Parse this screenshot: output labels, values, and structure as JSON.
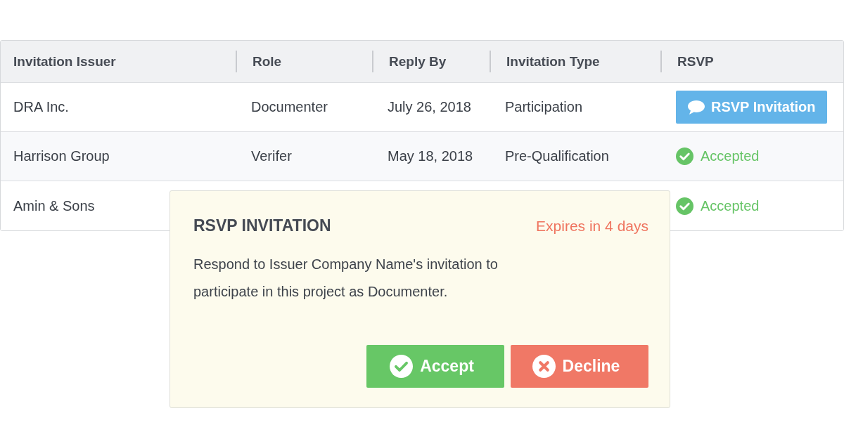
{
  "table": {
    "columns": [
      "Invitation Issuer",
      "Role",
      "Reply By",
      "Invitation Type",
      "RSVP"
    ],
    "rows": [
      {
        "issuer": "DRA Inc.",
        "role": "Documenter",
        "reply_by": "July 26, 2018",
        "invitation_type": "Participation",
        "rsvp": {
          "kind": "button",
          "label": "RSVP Invitation"
        }
      },
      {
        "issuer": "Harrison Group",
        "role": "Verifer",
        "reply_by": "May 18, 2018",
        "invitation_type": "Pre-Qualification",
        "rsvp": {
          "kind": "status",
          "label": "Accepted"
        }
      },
      {
        "issuer": "Amin & Sons",
        "rsvp": {
          "kind": "status",
          "label": "Accepted"
        }
      }
    ]
  },
  "popover": {
    "title": "RSVP INVITATION",
    "expiry": "Expires in 4 days",
    "message": "Respond to Issuer Company Name's invitation to participate in this project as Documenter.",
    "buttons": [
      {
        "kind": "accept",
        "label": "Accept"
      },
      {
        "kind": "decline",
        "label": "Decline"
      }
    ]
  }
}
